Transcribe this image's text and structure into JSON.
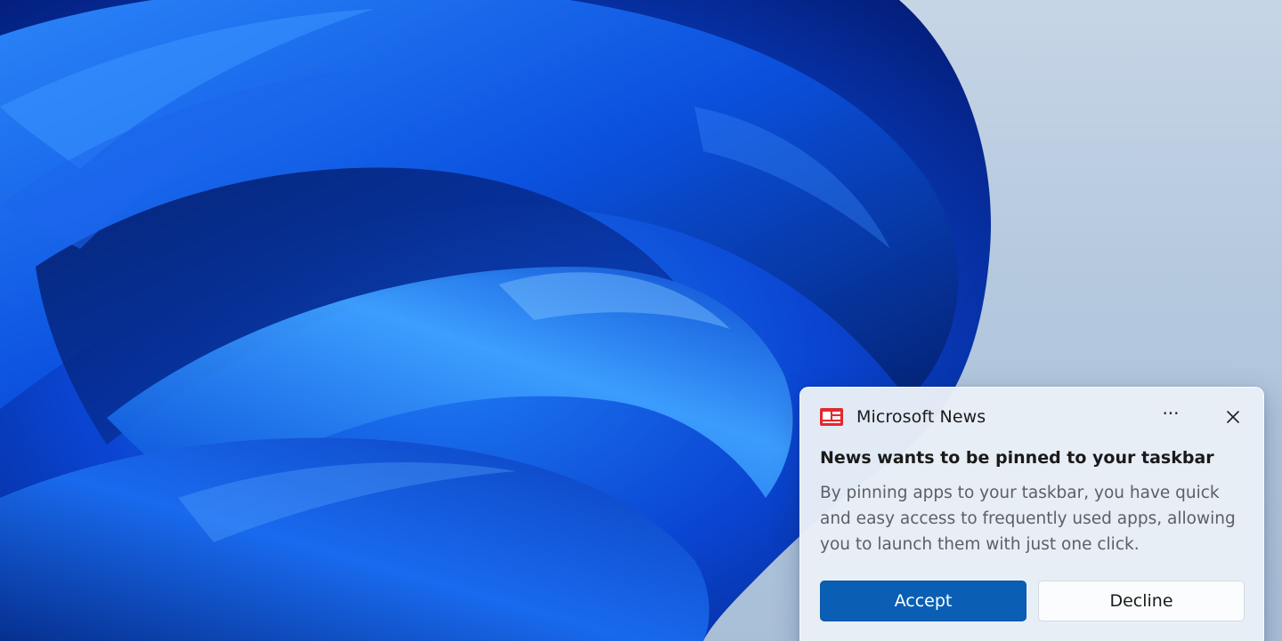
{
  "desktop": {
    "wallpaper": "windows-bloom-wallpaper"
  },
  "notification": {
    "app_icon": "news-icon",
    "app_name": "Microsoft News",
    "more_icon": "ellipsis-icon",
    "more_label": "···",
    "close_icon": "close-icon",
    "title": "News wants to be pinned to your taskbar",
    "body": "By pinning apps to your taskbar, you have quick and easy access to frequently used apps, allowing you to launch them with just one click.",
    "accept_label": "Accept",
    "decline_label": "Decline"
  },
  "colors": {
    "accent": "#0a5fb4",
    "news_icon": "#e0292f",
    "wallpaper_blue": "#0b49d6",
    "background": "#b4c8de"
  }
}
